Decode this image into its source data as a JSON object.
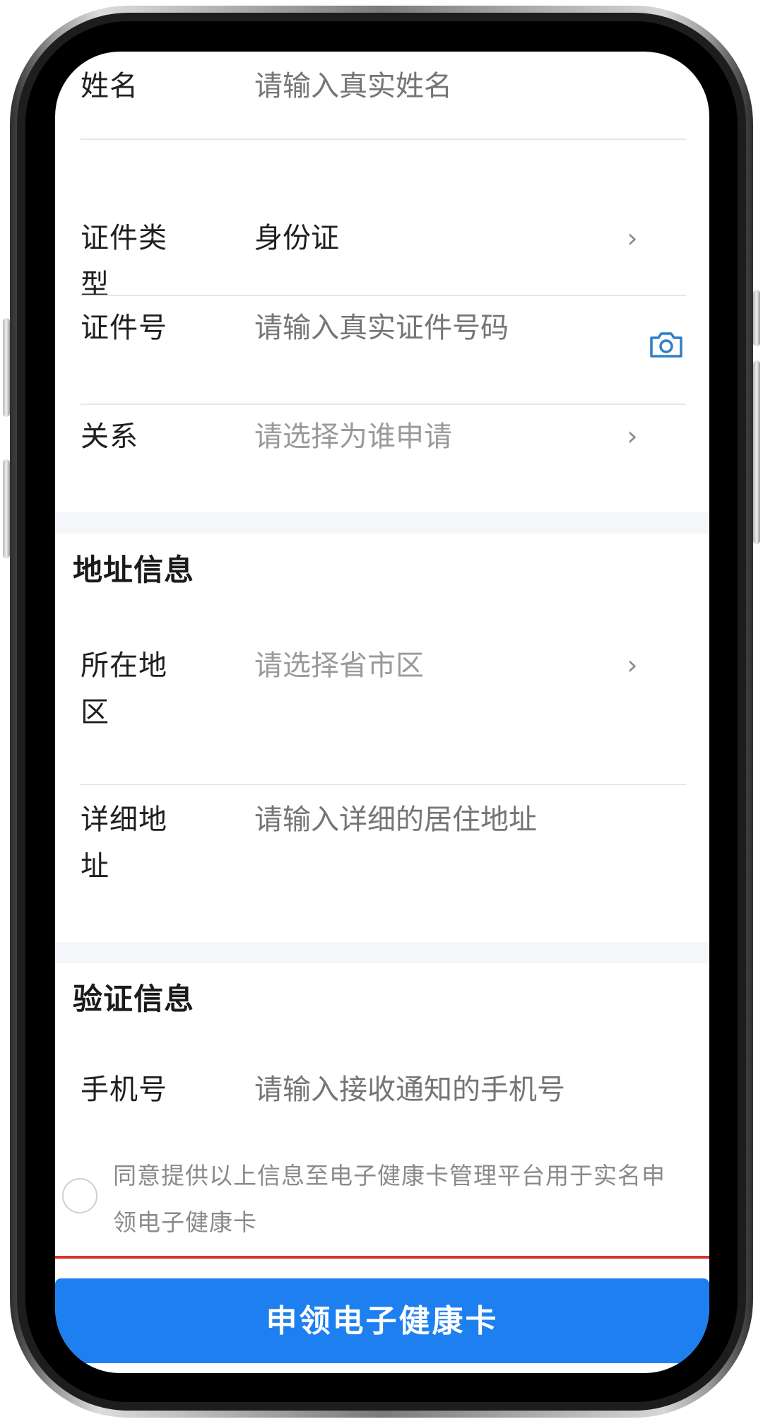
{
  "form": {
    "name": {
      "label": "姓名",
      "placeholder": "请输入真实姓名"
    },
    "id_type": {
      "label": "证件类型",
      "value": "身份证"
    },
    "id_number": {
      "label": "证件号",
      "placeholder": "请输入真实证件号码"
    },
    "relation": {
      "label": "关系",
      "placeholder": "请选择为谁申请"
    }
  },
  "address": {
    "title": "地址信息",
    "region": {
      "label": "所在地区",
      "placeholder": "请选择省市区"
    },
    "detail": {
      "label": "详细地址",
      "placeholder": "请输入详细的居住地址"
    }
  },
  "verify": {
    "title": "验证信息",
    "phone": {
      "label": "手机号",
      "placeholder": "请输入接收通知的手机号"
    }
  },
  "agreement": {
    "text": "同意提供以上信息至电子健康卡管理平台用于实名申领电子健康卡"
  },
  "submit": {
    "label": "申领电子健康卡"
  },
  "icons": {
    "chevron": "chevron-right-icon",
    "camera": "camera-icon"
  },
  "colors": {
    "primary_button": "#1e80f0",
    "accent_icon": "#2f7fc6",
    "placeholder": "#9a9a9a",
    "divider": "#e6e6e6",
    "warning_line": "#d9342b"
  }
}
